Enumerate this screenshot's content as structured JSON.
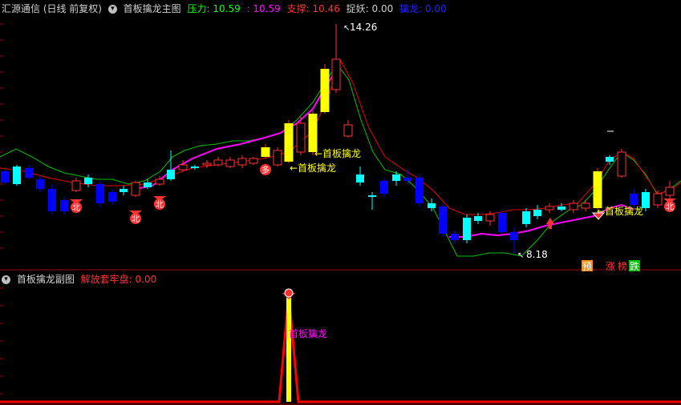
{
  "main_header": {
    "stock": "汇源通信 (日线 前复权)",
    "indicator": "首板擒龙主图",
    "pressure_label": "压力:",
    "pressure_value": "10.59",
    "value2": ": 10.59",
    "support_label": "支撑:",
    "support_value": "10.46",
    "catch_label": "捉妖:",
    "catch_value": "0.00",
    "dragon_label": "擒龙:",
    "dragon_value": "0.00"
  },
  "sub_header": {
    "indicator": "首板擒龙副图",
    "label": "解放套牢盘:",
    "value": "0.00"
  },
  "annotations": {
    "high": "14.26",
    "low": "8.18",
    "signal1": "←首板擒龙",
    "signal2": "←首板擒龙",
    "signal3": "←首板擒龙",
    "sub_signal": "首板擒龙",
    "duo": "多",
    "bei": "北",
    "pre": "预",
    "zhang": "涨",
    "bang": "榜",
    "die": "跌"
  },
  "colors": {
    "bg": "#000000",
    "up": "#ff3232",
    "down": "#0000ff",
    "flat": "#00ffff",
    "signal_candle": "#ffff00",
    "green_line": "#00c000",
    "red_line": "#e00000",
    "magenta_line": "#ff00ff",
    "pressure": "#00ff00",
    "support": "#ff3232",
    "dragon": "#2020ff",
    "grid": "#800000"
  }
}
